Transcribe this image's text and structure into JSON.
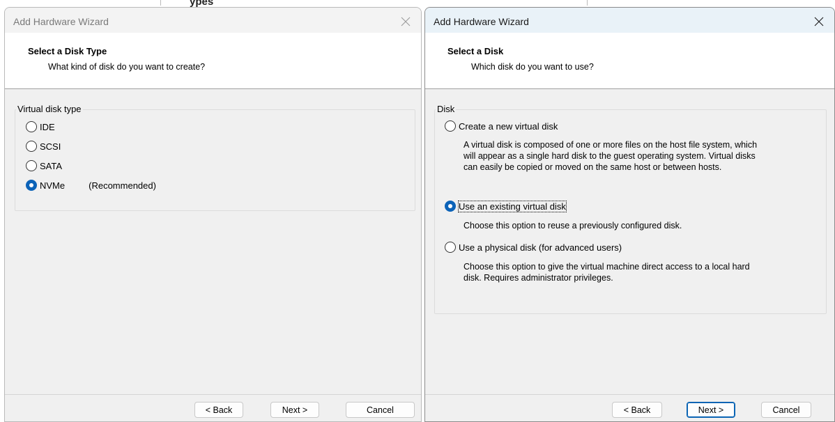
{
  "background": {
    "partial_text": "ypes"
  },
  "left_dialog": {
    "title": "Add Hardware Wizard",
    "header_title": "Select a Disk Type",
    "header_subtitle": "What kind of disk do you want to create?",
    "group_label": "Virtual disk type",
    "options": [
      {
        "label": "IDE",
        "checked": false
      },
      {
        "label": "SCSI",
        "checked": false
      },
      {
        "label": "SATA",
        "checked": false
      },
      {
        "label": "NVMe",
        "note": "(Recommended)",
        "checked": true
      }
    ],
    "buttons": {
      "back": "< Back",
      "next": "Next >",
      "cancel": "Cancel"
    }
  },
  "right_dialog": {
    "title": "Add Hardware Wizard",
    "header_title": "Select a Disk",
    "header_subtitle": "Which disk do you want to use?",
    "group_label": "Disk",
    "options": [
      {
        "label": "Create a new virtual disk",
        "checked": false,
        "description": [
          "A virtual disk is composed of one or more files on the host file system, which",
          "will appear as a single hard disk to the guest operating system. Virtual disks",
          "can easily be copied or moved on the same host or between hosts."
        ]
      },
      {
        "label": "Use an existing virtual disk",
        "checked": true,
        "description": [
          "Choose this option to reuse a previously configured disk."
        ]
      },
      {
        "label": "Use a physical disk (for advanced users)",
        "checked": false,
        "description": [
          "Choose this option to give the virtual machine direct access to a local hard",
          "disk. Requires administrator privileges."
        ]
      }
    ],
    "buttons": {
      "back": "< Back",
      "next": "Next >",
      "cancel": "Cancel"
    }
  },
  "colors": {
    "accent": "#0c63b8",
    "dialog_bg": "#f0f0f0",
    "header_bg": "#ffffff"
  }
}
